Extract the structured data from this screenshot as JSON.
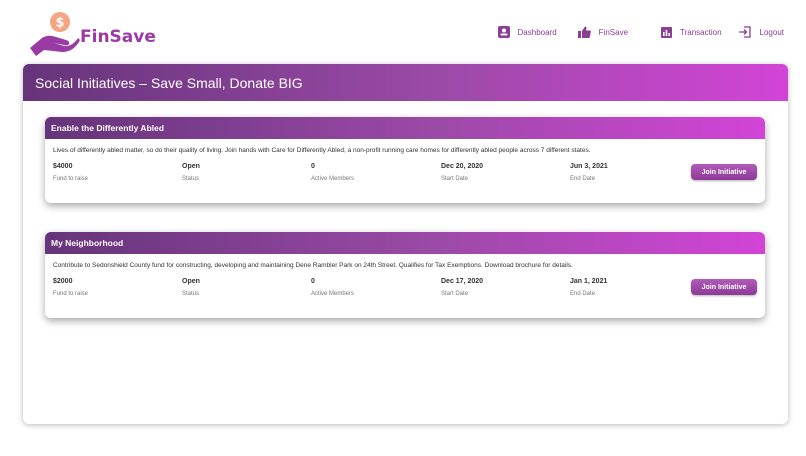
{
  "brand": {
    "name": "FinSave",
    "logo_icon": "hand-coin-icon",
    "color": "#9a3aa5"
  },
  "nav": [
    {
      "label": "Dashboard",
      "icon": "dashboard-icon"
    },
    {
      "label": "FinSave",
      "icon": "thumbs-up-icon"
    },
    {
      "label": "Transaction",
      "icon": "bar-chart-icon"
    },
    {
      "label": "Logout",
      "icon": "logout-icon"
    }
  ],
  "page": {
    "title": "Social Initiatives – Save Small, Donate BIG"
  },
  "initiatives": [
    {
      "title": "Enable the Differently Abled",
      "description": "Lives of differently abled matter, so do their quality of living. Join hands with Care for Differently Abled, a non-profit running care homes for differently abled people across 7 different states.",
      "fund": "$4000",
      "fund_label": "Fund to raise",
      "status": "Open",
      "status_label": "Status",
      "members": "0",
      "members_label": "Active Members",
      "start": "Dec 20, 2020",
      "start_label": "Start Date",
      "end": "Jun 3, 2021",
      "end_label": "End Date",
      "button": "Join Initiative"
    },
    {
      "title": "My Neighborhood",
      "description": "Contribute to Sedonshield County fund for constructing, developing and maintaining Dene Rambler Park on 24th Street. Qualifies for Tax Exemptions. Download brochure for details.",
      "fund": "$2000",
      "fund_label": "Fund to raise",
      "status": "Open",
      "status_label": "Status",
      "members": "0",
      "members_label": "Active Members",
      "start": "Dec 17, 2020",
      "start_label": "Start Date",
      "end": "Jan 1, 2021",
      "end_label": "End Date",
      "button": "Join Initiative"
    }
  ],
  "colors": {
    "header_start": "#66347a",
    "header_end": "#d244d6",
    "accent": "#8a3e94",
    "coin": "#f4a582"
  }
}
